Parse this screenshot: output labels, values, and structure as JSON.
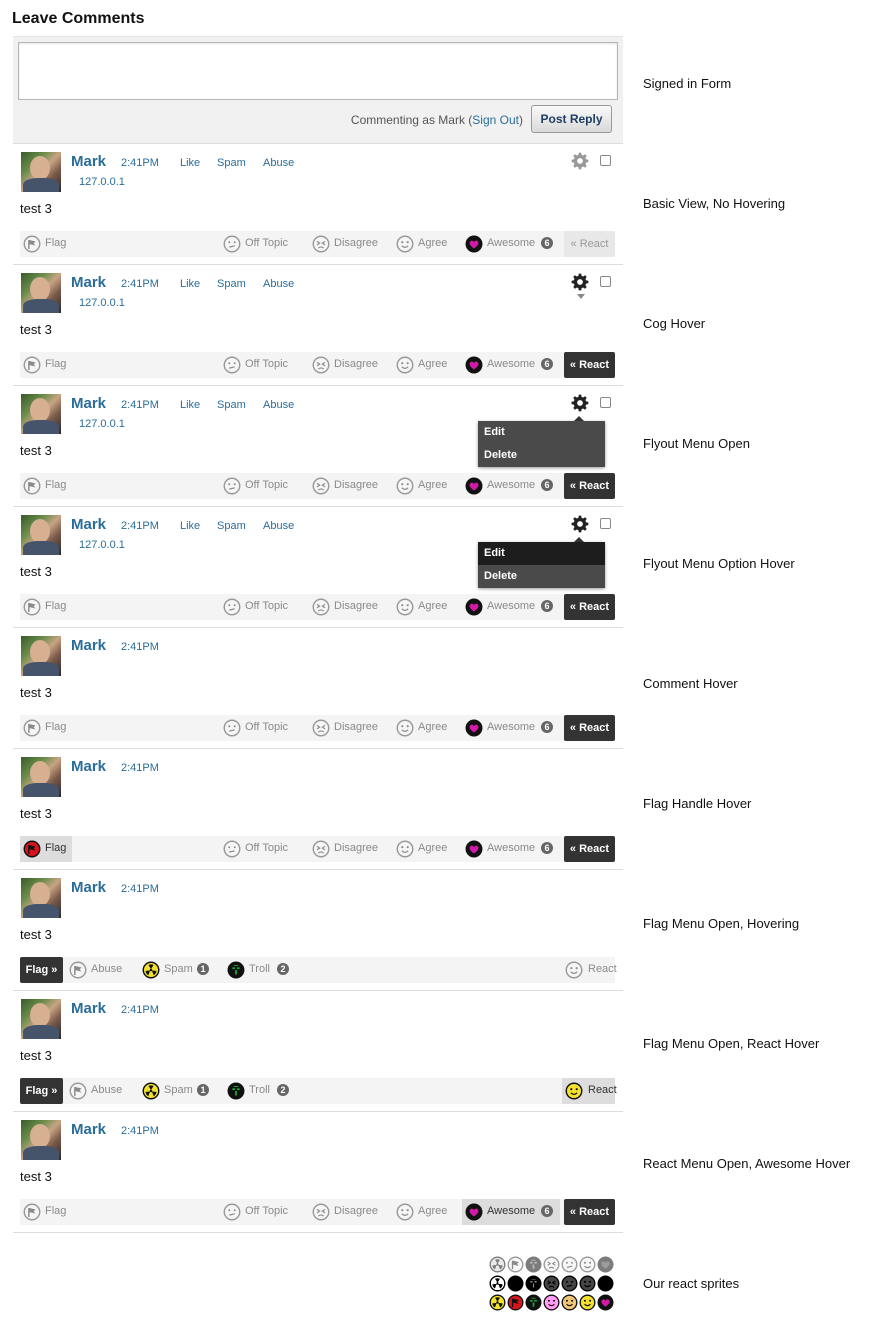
{
  "page": {
    "title": "Leave Comments"
  },
  "form": {
    "textarea_value": "",
    "commenting_prefix": "Commenting as Mark (",
    "signout_label": "Sign Out",
    "commenting_suffix": ")",
    "post_label": "Post Reply"
  },
  "comment": {
    "author": "Mark",
    "time": "2:41PM",
    "ip": "127.0.0.1",
    "body": "test 3",
    "mod_links": [
      "Like",
      "Spam",
      "Abuse"
    ]
  },
  "toolbar": {
    "flag_label": "Flag",
    "off_topic_label": "Off Topic",
    "disagree_label": "Disagree",
    "agree_label": "Agree",
    "awesome_label": "Awesome",
    "awesome_count": "6",
    "react_button_label": "« React"
  },
  "flag_menu": {
    "flag_button_label": "Flag »",
    "abuse_label": "Abuse",
    "spam_label": "Spam",
    "spam_count": "1",
    "troll_label": "Troll",
    "troll_count": "2",
    "react_label": "React"
  },
  "flyout": {
    "edit_label": "Edit",
    "delete_label": "Delete"
  },
  "states": [
    "Signed in Form",
    "Basic View, No Hovering",
    "Cog Hover",
    "Flyout Menu Open",
    "Flyout Menu Option Hover",
    "Comment Hover",
    "Flag Handle Hover",
    "Flag Menu Open, Hovering",
    "Flag Menu Open, React Hover",
    "React Menu Open, Awesome Hover",
    "Our react sprites"
  ],
  "colors": {
    "link": "#2a6d9a",
    "button_dark": "#333333",
    "awesome_magenta": "#b4169a",
    "spam_yellow": "#f2e22e",
    "troll_green": "#1fa53a",
    "flag_red": "#d9151b"
  },
  "icons": {
    "cog": "cog-icon",
    "flag": "flag-icon",
    "off_topic": "off-topic-icon",
    "disagree": "disagree-icon",
    "agree": "agree-icon",
    "awesome": "awesome-heart-icon",
    "spam": "spam-radiation-icon",
    "troll": "troll-icon",
    "react": "react-smiley-icon"
  }
}
